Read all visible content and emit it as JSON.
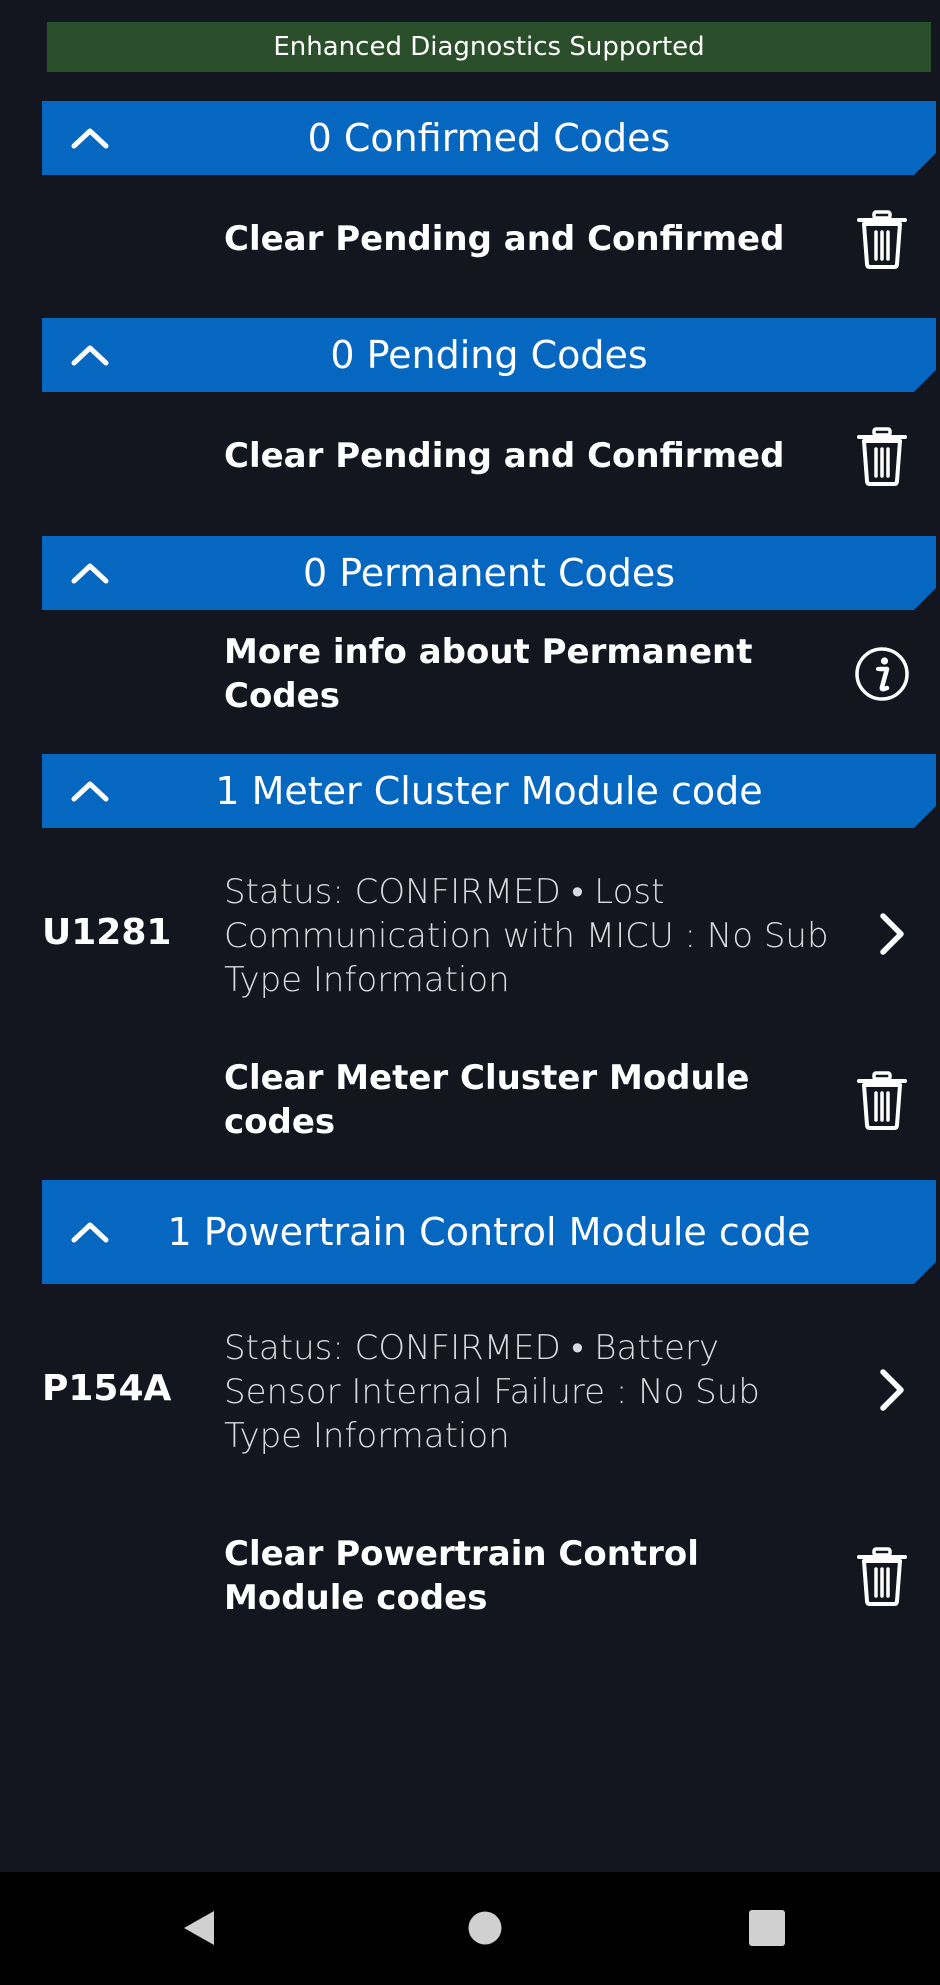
{
  "banner": {
    "text": "Enhanced Diagnostics Supported",
    "color": "#2a4f2a"
  },
  "colors": {
    "header": "#0567bf",
    "background": "#13161f"
  },
  "sections": [
    {
      "title": "0 Confirmed Codes",
      "action": {
        "label": "Clear Pending and Confirmed",
        "icon": "trash-icon"
      }
    },
    {
      "title": "0 Pending Codes",
      "action": {
        "label": "Clear Pending and Confirmed",
        "icon": "trash-icon"
      }
    },
    {
      "title": "0 Permanent Codes",
      "action": {
        "label": "More info about Permanent Codes",
        "icon": "info-icon"
      }
    },
    {
      "title": "1 Meter Cluster Module code",
      "dtc": {
        "code": "U1281",
        "description": "Status: CONFIRMED • Lost Communication with MICU : No Sub Type Information"
      },
      "action": {
        "label": "Clear Meter Cluster Module codes",
        "icon": "trash-icon"
      }
    },
    {
      "title": "1 Powertrain Control Module code",
      "dtc": {
        "code": "P154A",
        "description": "Status: CONFIRMED • Battery Sensor Internal Failure : No Sub Type Information"
      },
      "action": {
        "label": "Clear Powertrain Control Module codes",
        "icon": "trash-icon"
      }
    }
  ],
  "navigation": {
    "icons": [
      "back-icon",
      "home-icon",
      "recents-icon"
    ]
  }
}
